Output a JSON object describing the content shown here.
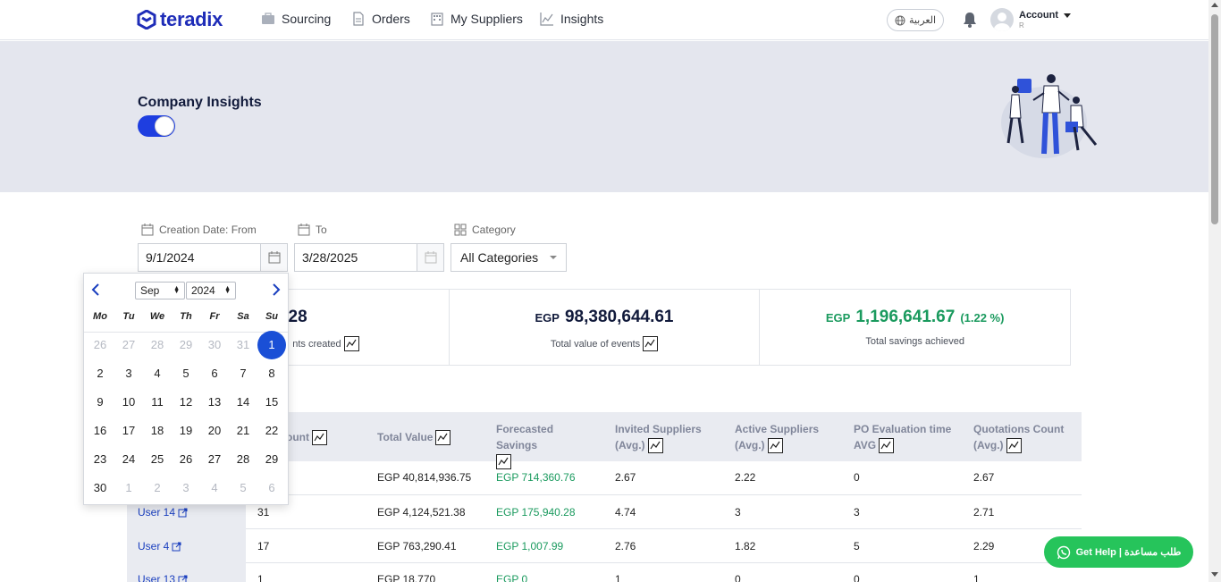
{
  "brand": {
    "name": "teradix",
    "color": "#1f2db8"
  },
  "nav": {
    "items": [
      {
        "label": "Sourcing",
        "icon": "briefcase-icon"
      },
      {
        "label": "Orders",
        "icon": "document-icon"
      },
      {
        "label": "My Suppliers",
        "icon": "building-icon"
      },
      {
        "label": "Insights",
        "icon": "line-chart-icon"
      }
    ],
    "language": "العربية",
    "account_label": "Account",
    "account_sub": "R"
  },
  "banner": {
    "title": "Company Insights",
    "toggle_on": true
  },
  "filters": {
    "from_label": "Creation Date: From",
    "from_value": "9/1/2024",
    "to_label": "To",
    "to_value": "3/28/2025",
    "category_label": "Category",
    "category_value": "All Categories"
  },
  "stats": [
    {
      "currency": "",
      "value": "28",
      "pct": "",
      "label": "nts created"
    },
    {
      "currency": "EGP",
      "value": "98,380,644.61",
      "pct": "",
      "label": "Total value of events"
    },
    {
      "currency": "EGP",
      "value": "1,196,641.67",
      "pct": "(1.22 %)",
      "label": "Total savings achieved"
    }
  ],
  "table": {
    "headers": [
      "ount",
      "Total Value",
      "Forecasted Savings",
      "Invited Suppliers (Avg.)",
      "Active Suppliers (Avg.)",
      "PO Evaluation time AVG",
      "Quotations Count (Avg.)"
    ],
    "rows": [
      {
        "user": "",
        "count": "",
        "total": "EGP 40,814,936.75",
        "savings": "EGP 714,360.76",
        "invited": "2.67",
        "active": "2.22",
        "po": "0",
        "quotes": "2.67"
      },
      {
        "user": "User 14",
        "count": "31",
        "total": "EGP 4,124,521.38",
        "savings": "EGP 175,940.28",
        "invited": "4.74",
        "active": "3",
        "po": "3",
        "quotes": "2.71"
      },
      {
        "user": "User 4",
        "count": "17",
        "total": "EGP 763,290.41",
        "savings": "EGP 1,007.99",
        "invited": "2.76",
        "active": "1.82",
        "po": "5",
        "quotes": "2.29"
      },
      {
        "user": "User 13",
        "count": "1",
        "total": "EGP 18,770",
        "savings": "EGP 0",
        "invited": "1",
        "active": "0",
        "po": "0",
        "quotes": "1"
      }
    ]
  },
  "datepicker": {
    "month": "Sep",
    "year": "2024",
    "weekdays": [
      "Mo",
      "Tu",
      "We",
      "Th",
      "Fr",
      "Sa",
      "Su"
    ],
    "weeks": [
      [
        "26",
        "27",
        "28",
        "29",
        "30",
        "31",
        "1"
      ],
      [
        "2",
        "3",
        "4",
        "5",
        "6",
        "7",
        "8"
      ],
      [
        "9",
        "10",
        "11",
        "12",
        "13",
        "14",
        "15"
      ],
      [
        "16",
        "17",
        "18",
        "19",
        "20",
        "21",
        "22"
      ],
      [
        "23",
        "24",
        "25",
        "26",
        "27",
        "28",
        "29"
      ],
      [
        "30",
        "1",
        "2",
        "3",
        "4",
        "5",
        "6"
      ]
    ],
    "selected_day": "1"
  },
  "help": {
    "label": "Get Help | طلب مساعدة"
  },
  "colors": {
    "accent": "#1e3ee0",
    "green": "#1a9a5e",
    "help_green": "#26c45b",
    "banner": "#e4e6ee"
  }
}
